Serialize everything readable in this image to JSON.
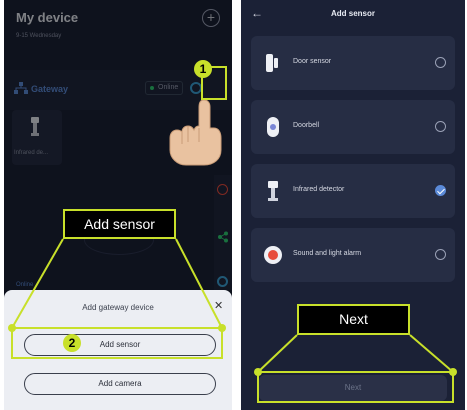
{
  "left_screen": {
    "title": "My device",
    "date": "9-15 Wednesday",
    "gateway_label": "Gateway",
    "online_label": "Online",
    "device_card_label": "Infrared de...",
    "bottom_online_label": "Online",
    "sheet": {
      "title": "Add gateway device",
      "close": "✕",
      "add_sensor_label": "Add sensor",
      "add_camera_label": "Add camera"
    }
  },
  "right_screen": {
    "back": "←",
    "title": "Add sensor",
    "items": [
      {
        "label": "Door sensor",
        "icon": "door-sensor-icon",
        "selected": false
      },
      {
        "label": "Doorbell",
        "icon": "doorbell-icon",
        "selected": false
      },
      {
        "label": "Infrared detector",
        "icon": "infrared-detector-icon",
        "selected": true
      },
      {
        "label": "Sound and light alarm",
        "icon": "alarm-icon",
        "selected": false
      }
    ],
    "next_label": "Next"
  },
  "annotations": {
    "callout_add_sensor": "Add sensor",
    "callout_next": "Next",
    "step_1": "1",
    "step_2": "2"
  },
  "colors": {
    "app_background": "#1b2136",
    "card_background": "#262d44",
    "accent_blue": "#5b8ad8",
    "highlight": "#c8e02a",
    "online_green": "#2ecc71",
    "alarm_red": "#e74c3c"
  }
}
